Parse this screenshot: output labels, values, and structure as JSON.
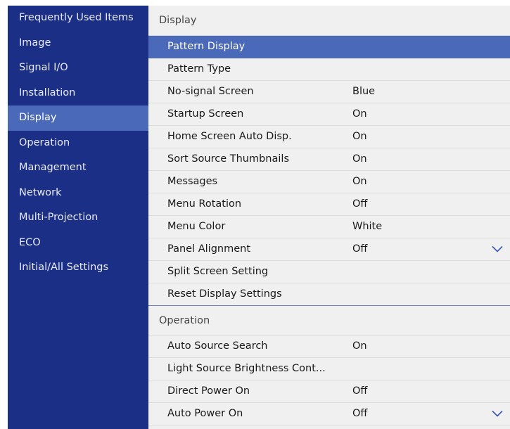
{
  "sidebar": {
    "items": [
      {
        "label": "Frequently Used Items"
      },
      {
        "label": "Image"
      },
      {
        "label": "Signal I/O"
      },
      {
        "label": "Installation"
      },
      {
        "label": "Display"
      },
      {
        "label": "Operation"
      },
      {
        "label": "Management"
      },
      {
        "label": "Network"
      },
      {
        "label": "Multi-Projection"
      },
      {
        "label": "ECO"
      },
      {
        "label": "Initial/All Settings"
      }
    ],
    "active_item": "Display"
  },
  "main": {
    "display_section": {
      "title": "Display",
      "rows": [
        {
          "label": "Pattern Display",
          "value": ""
        },
        {
          "label": "Pattern Type",
          "value": ""
        },
        {
          "label": "No-signal Screen",
          "value": "Blue"
        },
        {
          "label": "Startup Screen",
          "value": "On"
        },
        {
          "label": "Home Screen Auto Disp.",
          "value": "On"
        },
        {
          "label": "Sort Source Thumbnails",
          "value": "On"
        },
        {
          "label": "Messages",
          "value": "On"
        },
        {
          "label": "Menu Rotation",
          "value": "Off"
        },
        {
          "label": "Menu Color",
          "value": "White"
        },
        {
          "label": "Panel Alignment",
          "value": "Off"
        },
        {
          "label": "Split Screen Setting",
          "value": ""
        },
        {
          "label": "Reset Display Settings",
          "value": ""
        }
      ],
      "selected_row": "Pattern Display"
    },
    "operation_section": {
      "title": "Operation",
      "rows": [
        {
          "label": "Auto Source Search",
          "value": "On"
        },
        {
          "label": "Light Source Brightness Cont...",
          "value": ""
        },
        {
          "label": "Direct Power On",
          "value": "Off"
        },
        {
          "label": "Auto Power On",
          "value": "Off"
        }
      ]
    }
  },
  "icons": {
    "scroll_down": "chevron-down-icon"
  },
  "colors": {
    "sidebar_bg": "#1c2f86",
    "highlight": "#4a6ab9",
    "main_bg": "#f0f0f0",
    "chevron": "#3b57b0"
  }
}
